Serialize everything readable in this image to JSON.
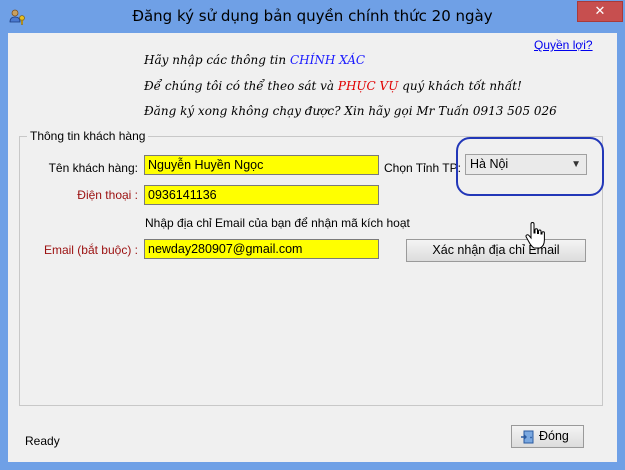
{
  "window": {
    "title": "Đăng ký sử dụng bản quyền chính thức 20 ngày",
    "close_label": "✕"
  },
  "links": {
    "rights": "Quyền lợi?"
  },
  "info": {
    "line1_prefix": "Hãy nhập các thông tin ",
    "line1_emphasis": "CHÍNH XÁC",
    "line2_prefix": "Để chúng tôi có thể theo sát và ",
    "line2_emphasis": "PHỤC VỤ",
    "line2_suffix": " quý khách tốt nhất!",
    "line3": "Đăng ký xong không chạy được? Xin hãy gọi Mr Tuấn 0913 505 026"
  },
  "group": {
    "title": "Thông tin khách hàng",
    "customer_name_label": "Tên khách hàng:",
    "customer_name_value": "Nguyễn Huyền Ngọc",
    "province_label": "Chọn Tỉnh TP:",
    "province_value": "Hà Nội",
    "phone_label": "Điện thoại :",
    "phone_value": "0936141136",
    "email_hint": "Nhập địa chỉ Email của bạn để nhận mã kích hoạt",
    "email_label": "Email (bắt buộc) :",
    "email_value": "newday280907@gmail.com",
    "confirm_email_button": "Xác nhận địa chỉ Email"
  },
  "footer": {
    "status": "Ready",
    "close_button": "Đóng"
  },
  "colors": {
    "title_bar": "#6fa0e6",
    "field_highlight": "#ffff00",
    "emphasis_red": "#e00000",
    "emphasis_blue": "#1a1aff",
    "required_label": "#9b1010",
    "ring": "#2237b8"
  },
  "icons": {
    "app": "users-key-icon",
    "close_door": "exit-door-icon",
    "pointer": "hand-pointer-icon"
  }
}
